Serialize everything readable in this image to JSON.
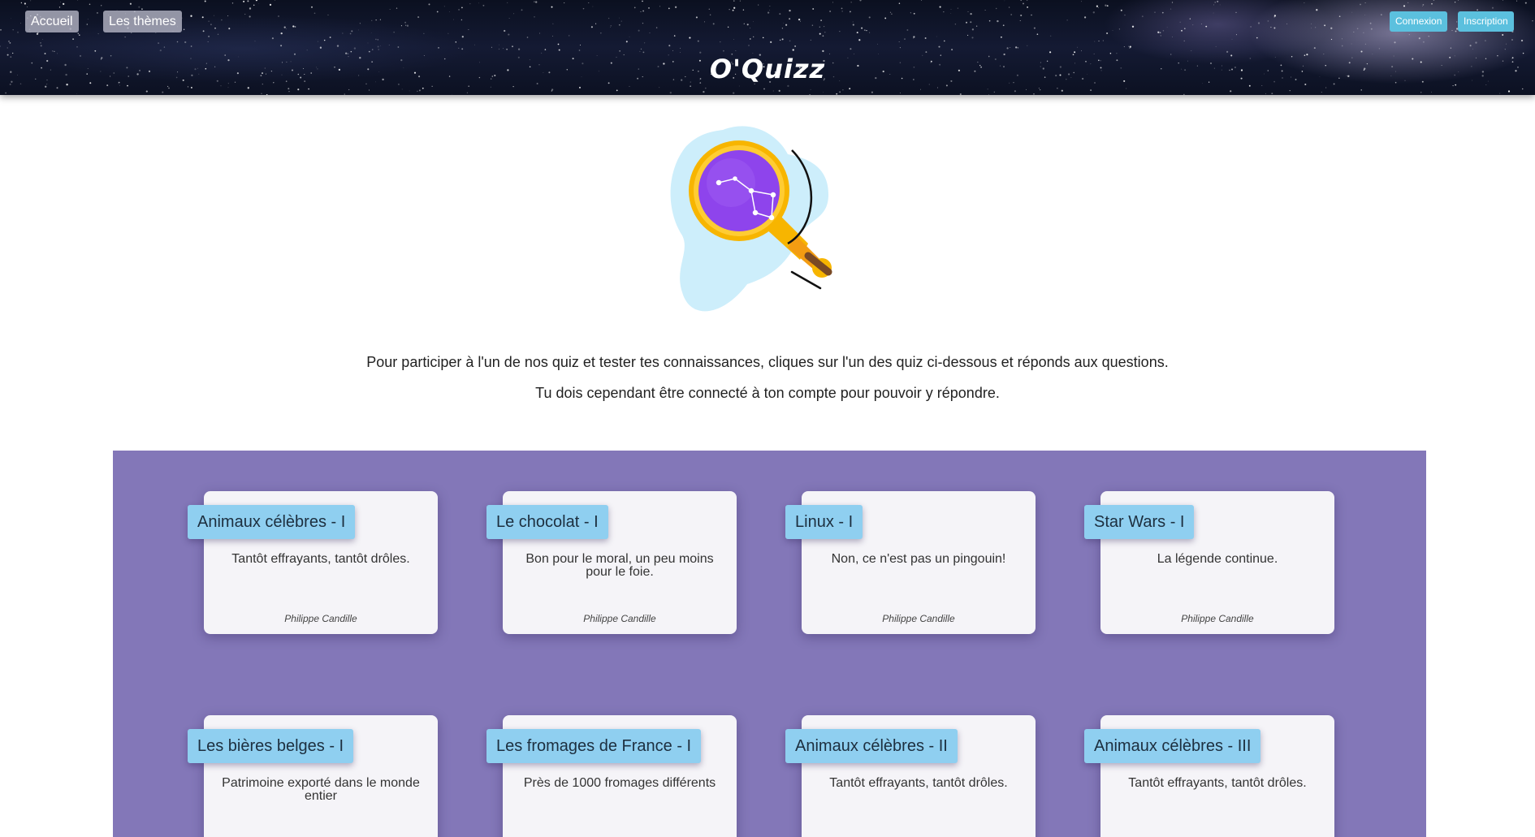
{
  "header": {
    "nav": [
      {
        "label": "Accueil"
      },
      {
        "label": "Les thèmes"
      }
    ],
    "auth": [
      {
        "label": "Connexion",
        "color": "#5bc0de"
      },
      {
        "label": "Inscription",
        "color": "#5bc0de"
      }
    ],
    "brand": "O'Quizz"
  },
  "hero": {
    "illustration": "telescope-icon"
  },
  "intro": {
    "line1": "Pour participer à l'un de nos quiz et tester tes connaissances, cliques sur l'un des quiz ci-dessous et réponds aux questions.",
    "line2": "Tu dois cependant être connecté à ton compte pour pouvoir y répondre."
  },
  "colors": {
    "section_bg": "#8377b8",
    "card_title_bg": "#8fcff0",
    "card_bg": "#f5f4f8"
  },
  "quizzes": [
    {
      "title": "Animaux célèbres - I",
      "description": "Tantôt effrayants, tantôt drôles.",
      "author": "Philippe Candille"
    },
    {
      "title": "Le chocolat - I",
      "description": "Bon pour le moral, un peu moins pour le foie.",
      "author": "Philippe Candille"
    },
    {
      "title": "Linux - I",
      "description": "Non, ce n'est pas un pingouin!",
      "author": "Philippe Candille"
    },
    {
      "title": "Star Wars - I",
      "description": "La légende continue.",
      "author": "Philippe Candille"
    },
    {
      "title": "Les bières belges - I",
      "description": "Patrimoine exporté dans le monde entier",
      "author": ""
    },
    {
      "title": "Les fromages de France - I",
      "description": "Près de 1000 fromages différents",
      "author": ""
    },
    {
      "title": "Animaux célèbres - II",
      "description": "Tantôt effrayants, tantôt drôles.",
      "author": ""
    },
    {
      "title": "Animaux célèbres - III",
      "description": "Tantôt effrayants, tantôt drôles.",
      "author": ""
    }
  ]
}
